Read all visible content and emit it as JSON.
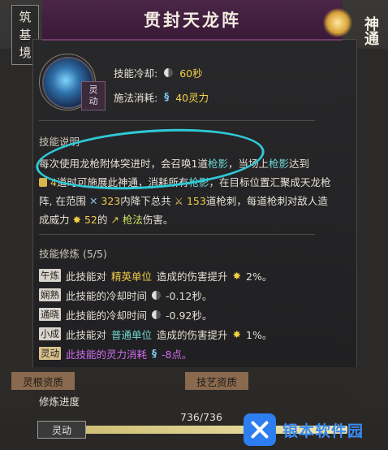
{
  "realm": {
    "chars": [
      "筑",
      "基",
      "境"
    ]
  },
  "title": "贯封天龙阵",
  "rank": {
    "text": "神通"
  },
  "skill": {
    "icon": "spear-icon",
    "tag_chars": [
      "灵",
      "动"
    ],
    "cooldown_label": "技能冷却:",
    "cooldown_value": "60秒",
    "cost_label": "施法消耗:",
    "cost_value": "40灵力"
  },
  "desc": {
    "heading": "技能说明",
    "p1": "每次使用龙枪附体突进时，会召唤1道",
    "p1_blue": "枪影",
    "p1_b": "，当场上",
    "p1_blue2": "枪影",
    "p1_c": "达到",
    "p2_num": "4",
    "p2_a": "道时可施展此神通，消耗所有",
    "p2_blue": "枪影",
    "p2_b": "，在目标位置汇聚成天龙枪",
    "p3_a": "阵, 在范围",
    "p3_num1": "323",
    "p3_b": "内降下总共",
    "p3_num2": "153",
    "p3_c": "道枪刺，每道枪刺对敌人造",
    "p4_a": "成威力",
    "p4_num": "52",
    "p4_b": "的",
    "p4_green": "枪法",
    "p4_c": "伤害。"
  },
  "cultivation": {
    "heading": "技能修炼 (5/5)",
    "rows": [
      {
        "tag": "午炼",
        "pre": "此技能对",
        "hl": "精英单位",
        "post": "造成的伤害提升",
        "value": "2%。"
      },
      {
        "tag": "娴熟",
        "pre": "此技能的冷却时间",
        "hl": "",
        "post": "",
        "value": "-0.12秒。"
      },
      {
        "tag": "通晓",
        "pre": "此技能的冷却时间",
        "hl": "",
        "post": "",
        "value": "-0.92秒。"
      },
      {
        "tag": "小成",
        "pre": "此技能对",
        "hl": "普通单位",
        "post": "造成的伤害提升",
        "value": "1%。"
      },
      {
        "tag": "灵动",
        "pre": "此技能的灵力消耗",
        "hl": "",
        "post": "",
        "value": "-8点。"
      }
    ]
  },
  "bottom": {
    "tab_left": "灵根资质",
    "tab_right": "技艺资质",
    "progress_label": "修炼进度",
    "progress_count": "736/736",
    "progress_fraction": 1.0,
    "chip": "灵动"
  },
  "watermark": {
    "text": "银本软件园"
  },
  "colors": {
    "title_bar": "#4a2547",
    "accent_blue": "#6cd8d0",
    "accent_yellow": "#f0cc4a",
    "accent_purple": "#d06cf0",
    "annotation": "#2fc9d6"
  }
}
